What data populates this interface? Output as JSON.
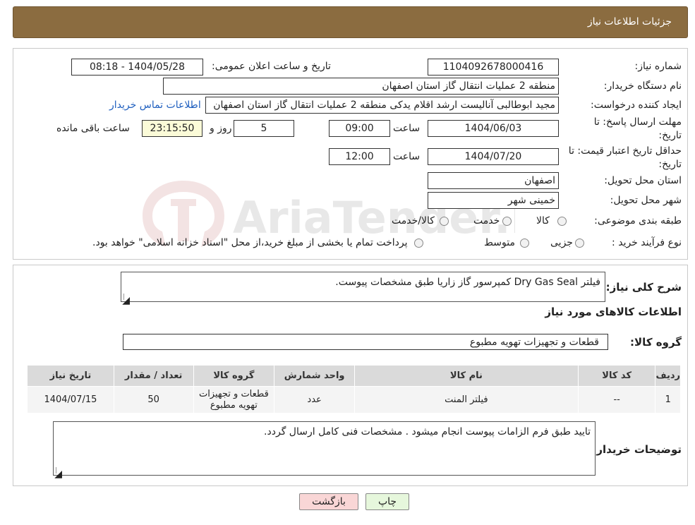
{
  "header": {
    "title": "جزئیات اطلاعات نیاز"
  },
  "fields": {
    "need_number_label": "شماره نیاز:",
    "need_number": "1104092678000416",
    "announce_label": "تاریخ و ساعت اعلان عمومی:",
    "announce_value": "1404/05/28 - 08:18",
    "buyer_org_label": "نام دستگاه خریدار:",
    "buyer_org": "منطقه 2 عملیات انتقال گاز استان اصفهان",
    "creator_label": "ایجاد کننده درخواست:",
    "creator": "مجید ابوطالبی آنالیست ارشد اقلام یدکی منطقه 2 عملیات انتقال گاز استان اصفهان",
    "contact_link": "اطلاعات تماس خریدار",
    "deadline_label_1": "مهلت ارسال پاسخ: تا",
    "deadline_label_2": "تاریخ:",
    "deadline_date": "1404/06/03",
    "time_label": "ساعت",
    "deadline_time": "09:00",
    "days_value": "5",
    "days_label": "روز و",
    "remaining_time": "23:15:50",
    "remaining_label": "ساعت باقی مانده",
    "validity_label_1": "حداقل تاریخ اعتبار قیمت: تا",
    "validity_label_2": "تاریخ:",
    "validity_date": "1404/07/20",
    "validity_time_label": "ساعت",
    "validity_time": "12:00",
    "province_label": "استان محل تحویل:",
    "province": "اصفهان",
    "city_label": "شهر محل تحویل:",
    "city": "خمینی شهر",
    "category_label": "طبقه بندی موضوعی:",
    "category_options": [
      "کالا",
      "خدمت",
      "کالا/خدمت"
    ],
    "process_label": "نوع فرآیند خرید :",
    "process_options": [
      "جزیی",
      "متوسط"
    ],
    "payment_note": "پرداخت تمام یا بخشی از مبلغ خرید،از محل \"اسناد خزانه اسلامی\" خواهد بود."
  },
  "summary": {
    "title": "شرح کلی نیاز:",
    "text": "فیلتر Dry Gas Seal کمپرسور گاز زاریا طبق مشخصات پیوست."
  },
  "goods": {
    "section_title": "اطلاعات کالاهای مورد نیاز",
    "group_label": "گروه کالا:",
    "group_value": "قطعات و تجهیزات تهویه مطبوع",
    "columns": [
      "ردیف",
      "کد کالا",
      "نام کالا",
      "واحد شمارش",
      "گروه کالا",
      "تعداد / مقدار",
      "تاریخ نیاز"
    ],
    "rows": [
      {
        "row": "1",
        "code": "--",
        "name": "فیلتر المنت",
        "unit": "عدد",
        "group_1": "قطعات و تجهیزات",
        "group_2": "تهویه مطبوع",
        "qty": "50",
        "date": "1404/07/15"
      }
    ]
  },
  "buyer_notes": {
    "label": "توضیحات خریدار:",
    "text": "تایید طبق فرم الزامات پیوست انجام میشود . مشخصات فنی کامل ارسال گردد."
  },
  "buttons": {
    "print": "چاپ",
    "back": "بازگشت"
  },
  "watermark": {
    "text": "AriaTender.neT"
  },
  "colors": {
    "header_bg": "#8b6c40",
    "link": "#1f5fbf",
    "back_btn_bg": "#f9d6d6",
    "print_btn_bg": "#e6f7dc"
  }
}
